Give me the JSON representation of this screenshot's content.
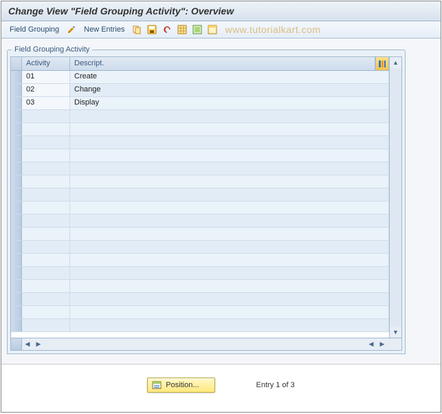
{
  "title": "Change View \"Field Grouping Activity\": Overview",
  "toolbar": {
    "field_grouping_label": "Field Grouping",
    "new_entries_label": "New Entries"
  },
  "watermark": "www.tutorialkart.com",
  "group_title": "Field Grouping Activity",
  "columns": {
    "activity": "Activity",
    "descript": "Descript."
  },
  "rows": [
    {
      "activity": "01",
      "descript": "Create"
    },
    {
      "activity": "02",
      "descript": "Change"
    },
    {
      "activity": "03",
      "descript": "Display"
    }
  ],
  "empty_row_count": 17,
  "footer": {
    "position_label": "Position...",
    "entry_status": "Entry 1 of 3"
  }
}
